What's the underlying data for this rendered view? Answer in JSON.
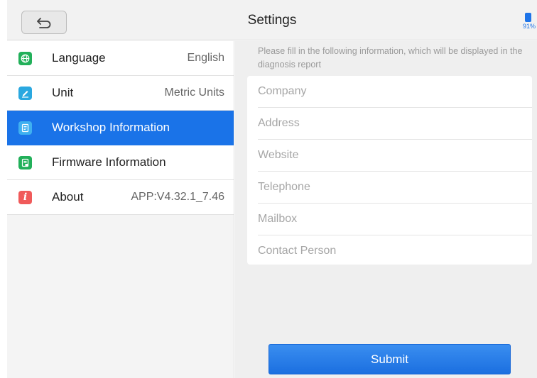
{
  "header": {
    "title": "Settings",
    "back_icon": "back-arrow-icon",
    "battery_text": "91%"
  },
  "sidebar": {
    "items": [
      {
        "label": "Language",
        "value": "English",
        "icon": "globe-icon",
        "color": "#22b05a",
        "active": false
      },
      {
        "label": "Unit",
        "value": "Metric Units",
        "icon": "pencil-icon",
        "color": "#2aa8e0",
        "active": false
      },
      {
        "label": "Workshop Information",
        "value": "",
        "icon": "document-icon",
        "color": "#3fb0f0",
        "active": true
      },
      {
        "label": "Firmware Information",
        "value": "",
        "icon": "firmware-doc-icon",
        "color": "#22b05a",
        "active": false
      },
      {
        "label": "About",
        "value": "APP:V4.32.1_7.46",
        "icon": "info-icon",
        "color": "#f05a5a",
        "active": false
      }
    ]
  },
  "main": {
    "hint": "Please fill in the following information, which will be displayed in the diagnosis report",
    "fields": [
      {
        "placeholder": "Company",
        "value": ""
      },
      {
        "placeholder": "Address",
        "value": ""
      },
      {
        "placeholder": "Website",
        "value": ""
      },
      {
        "placeholder": "Telephone",
        "value": ""
      },
      {
        "placeholder": "Mailbox",
        "value": ""
      },
      {
        "placeholder": "Contact Person",
        "value": ""
      }
    ],
    "submit_label": "Submit"
  },
  "colors": {
    "accent": "#1a73e8",
    "active_item_bg": "#1a73e8"
  }
}
